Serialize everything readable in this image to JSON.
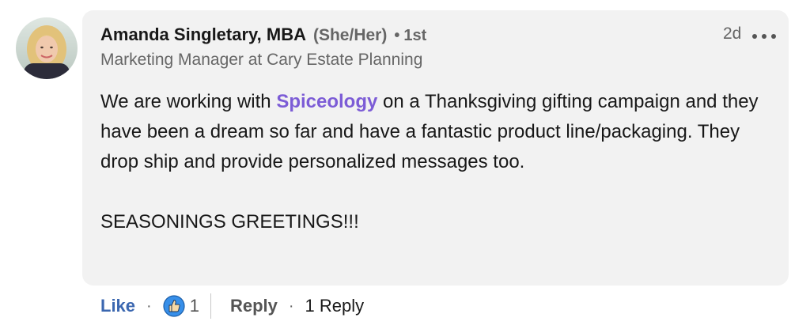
{
  "comment": {
    "author": {
      "name": "Amanda Singletary, MBA",
      "pronouns": "(She/Her)",
      "degree_dot": "•",
      "degree": "1st",
      "headline": "Marketing Manager at Cary Estate Planning"
    },
    "timestamp": "2d",
    "body": {
      "before_mention": "We are working with ",
      "mention": "Spiceology",
      "after_mention": " on a Thanksgiving gifting campaign and they have been a dream so far and have a fantastic product line/packaging. They drop ship and provide personalized messages too.",
      "greeting": "SEASONINGS GREETINGS!!!"
    },
    "actions": {
      "like_label": "Like",
      "separator": "·",
      "reaction_count": "1",
      "reply_label": "Reply",
      "reply_count_label": "1 Reply"
    }
  },
  "colors": {
    "bubble_bg": "#f2f2f2",
    "mention": "#7c5cd6",
    "like": "#3b67b0",
    "reaction_icon": "#378fe9"
  },
  "icons": {
    "more": "more-icon",
    "reaction": "like-reaction-icon"
  }
}
